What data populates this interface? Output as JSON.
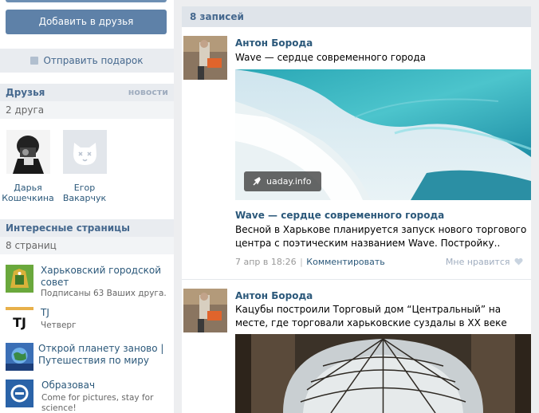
{
  "profile": {
    "add_friend_label": "Добавить в друзья",
    "gift_label": "Отправить подарок"
  },
  "friends": {
    "title": "Друзья",
    "news_link": "новости",
    "count": "2 друга",
    "items": [
      {
        "first": "Дарья",
        "last": "Кошечкина"
      },
      {
        "first": "Егор",
        "last": "Вакарчук"
      }
    ]
  },
  "interesting": {
    "title": "Интересные страницы",
    "count": "8 страниц",
    "items": [
      {
        "name": "Харьковский городской совет",
        "desc": "Подписаны 63 Ваших друга."
      },
      {
        "name": "TJ",
        "desc": "Четверг"
      },
      {
        "name": "Открой планету заново | Путешествия по миру",
        "desc": ""
      },
      {
        "name": "Образовач",
        "desc": "Come for pictures, stay for science!"
      }
    ]
  },
  "wall": {
    "header": "8 записей",
    "posts": [
      {
        "author": "Антон Борода",
        "text": "Wave — сердце современного города",
        "chip": "uaday.info",
        "link_title": "Wave — сердце современного города",
        "link_desc": "Весной в Харькове планируется запуск нового торгового центра с поэтическим названием Wave. Постройку..",
        "date": "7 апр в 18:26",
        "comment": "Комментировать",
        "like": "Мне нравится"
      },
      {
        "author": "Антон Борода",
        "text": "Кацубы построили Торговый дом “Центральный” на месте, где торговали харьковские суздалы в XX веке"
      }
    ]
  },
  "icons": {
    "gift": "gift-icon",
    "link": "link-icon",
    "heart": "heart-icon"
  },
  "colors": {
    "accent": "#5e81a8",
    "link": "#2b587a",
    "header_bg": "#e9ecf0"
  }
}
